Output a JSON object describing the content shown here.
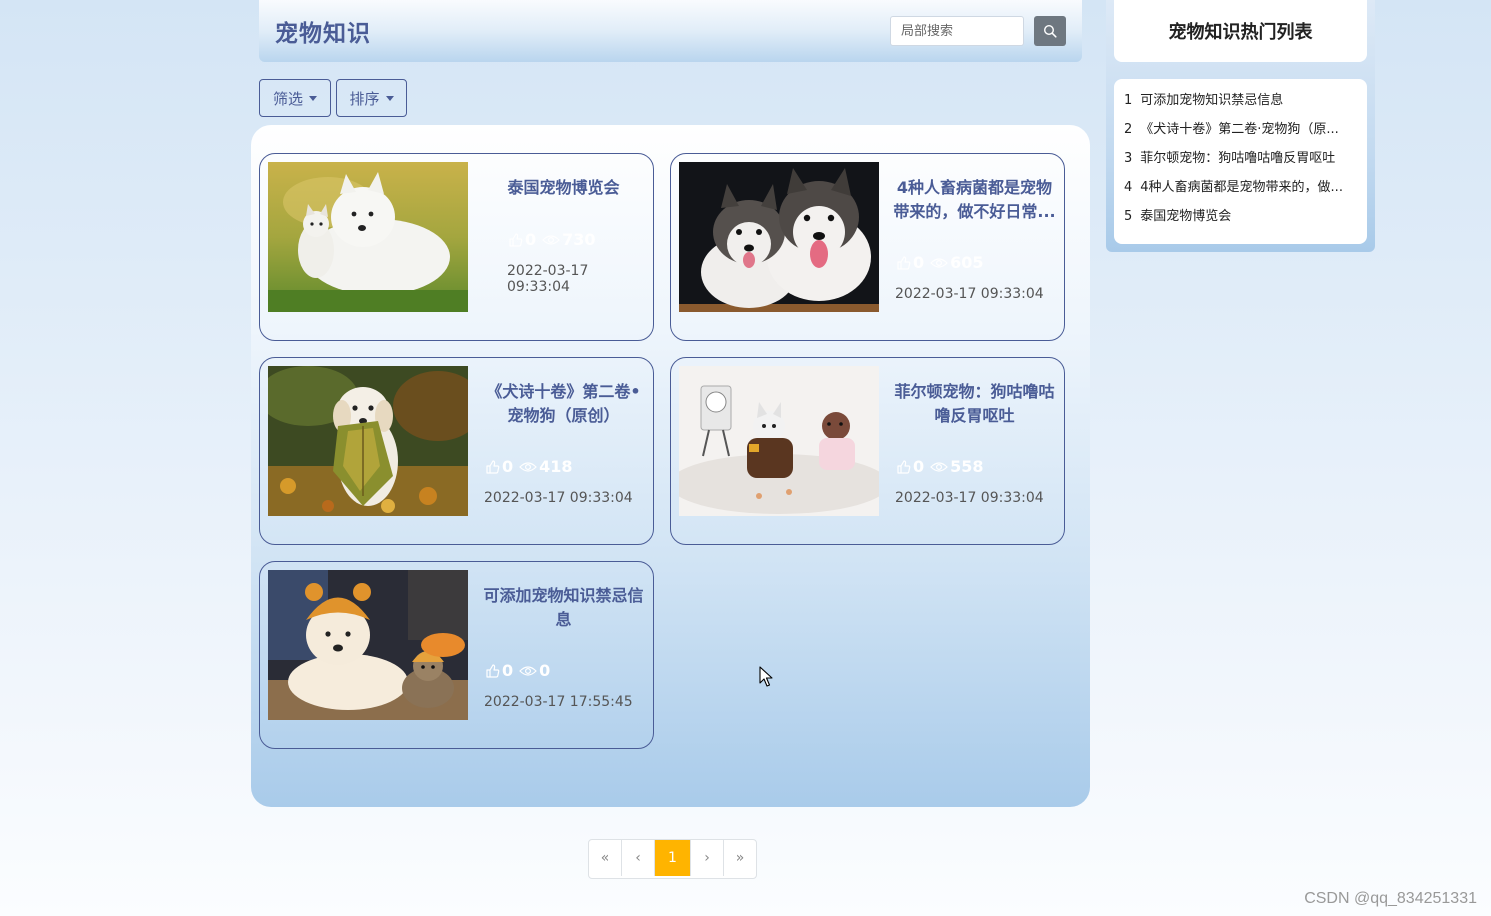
{
  "header": {
    "title": "宠物知识",
    "search_placeholder": "局部搜索"
  },
  "toolbar": {
    "filter_label": "筛选",
    "sort_label": "排序"
  },
  "cards": [
    {
      "title": "泰国宠物博览会",
      "likes": "0",
      "views": "730",
      "date": "2022-03-17 09:33:04",
      "image": "samoyed-with-puppy"
    },
    {
      "title": "4种人畜病菌都是宠物带来的，做不好日常...",
      "likes": "0",
      "views": "605",
      "date": "2022-03-17 09:33:04",
      "image": "husky-puppies"
    },
    {
      "title": "《犬诗十卷》第二卷•宠物狗（原创）",
      "likes": "0",
      "views": "418",
      "date": "2022-03-17 09:33:04",
      "image": "dog-holding-leaf"
    },
    {
      "title": "菲尔顿宠物：狗咕噜咕噜反胃呕吐",
      "likes": "0",
      "views": "558",
      "date": "2022-03-17 09:33:04",
      "image": "dogs-in-costumes"
    },
    {
      "title": "可添加宠物知识禁忌信息",
      "likes": "0",
      "views": "0",
      "date": "2022-03-17 17:55:45",
      "image": "dog-and-cat-with-hats"
    }
  ],
  "sidebar": {
    "title": "宠物知识热门列表",
    "items": [
      {
        "num": "1",
        "label": "可添加宠物知识禁忌信息"
      },
      {
        "num": "2",
        "label": "《犬诗十卷》第二卷·宠物狗（原..."
      },
      {
        "num": "3",
        "label": "菲尔顿宠物：狗咕噜咕噜反胃呕吐"
      },
      {
        "num": "4",
        "label": "4种人畜病菌都是宠物带来的，做..."
      },
      {
        "num": "5",
        "label": "泰国宠物博览会"
      }
    ]
  },
  "pagination": {
    "first": "«",
    "prev": "‹",
    "current": "1",
    "next": "›",
    "last": "»"
  },
  "watermark": "CSDN @qq_834251331",
  "colors": {
    "accent": "#4a5c96",
    "page_active": "#ffb400"
  }
}
